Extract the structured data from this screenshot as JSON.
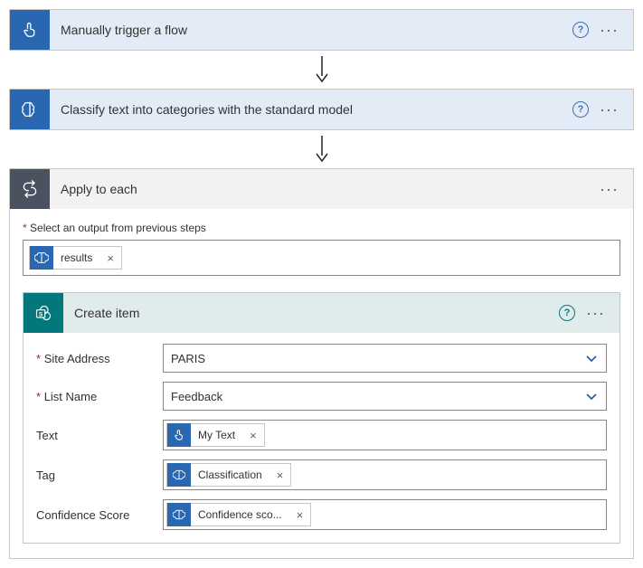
{
  "steps": {
    "trigger": {
      "title": "Manually trigger a flow"
    },
    "classify": {
      "title": "Classify text into categories with the standard model"
    },
    "apply": {
      "title": "Apply to each"
    }
  },
  "applyBody": {
    "outputLabelPrefix": "*",
    "outputLabel": "Select an output from previous steps",
    "outputToken": "results"
  },
  "createItem": {
    "title": "Create item",
    "fields": {
      "siteAddress": {
        "label": "Site Address",
        "required": "*",
        "value": "PARIS"
      },
      "listName": {
        "label": "List Name",
        "required": "*",
        "value": "Feedback"
      },
      "text": {
        "label": "Text",
        "token": "My Text"
      },
      "tag": {
        "label": "Tag",
        "token": "Classification"
      },
      "confidence": {
        "label": "Confidence Score",
        "token": "Confidence sco..."
      }
    }
  },
  "glyphs": {
    "help": "?",
    "more": "···",
    "close": "×"
  }
}
